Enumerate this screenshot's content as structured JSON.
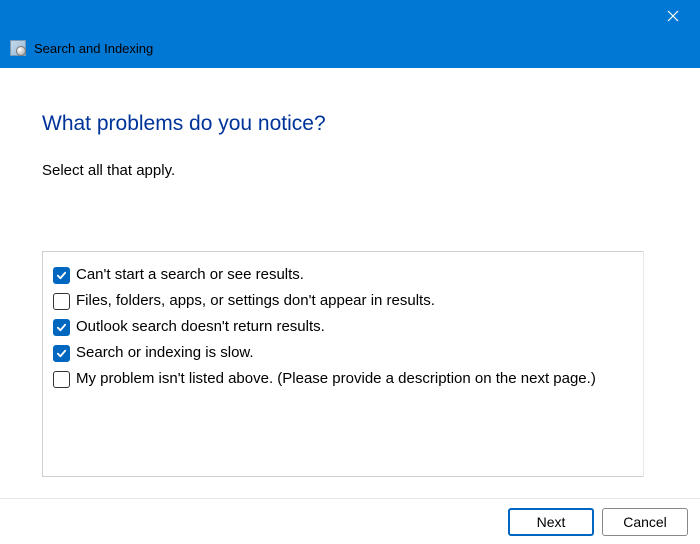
{
  "window": {
    "title": "Search and Indexing"
  },
  "main": {
    "heading": "What problems do you notice?",
    "subheading": "Select all that apply."
  },
  "options": [
    {
      "label": "Can't start a search or see results.",
      "checked": true
    },
    {
      "label": "Files, folders, apps, or settings don't appear in results.",
      "checked": false
    },
    {
      "label": "Outlook search doesn't return results.",
      "checked": true
    },
    {
      "label": "Search or indexing is slow.",
      "checked": true
    },
    {
      "label": "My problem isn't listed above. (Please provide a description on the next page.)",
      "checked": false
    }
  ],
  "footer": {
    "next": "Next",
    "cancel": "Cancel"
  }
}
